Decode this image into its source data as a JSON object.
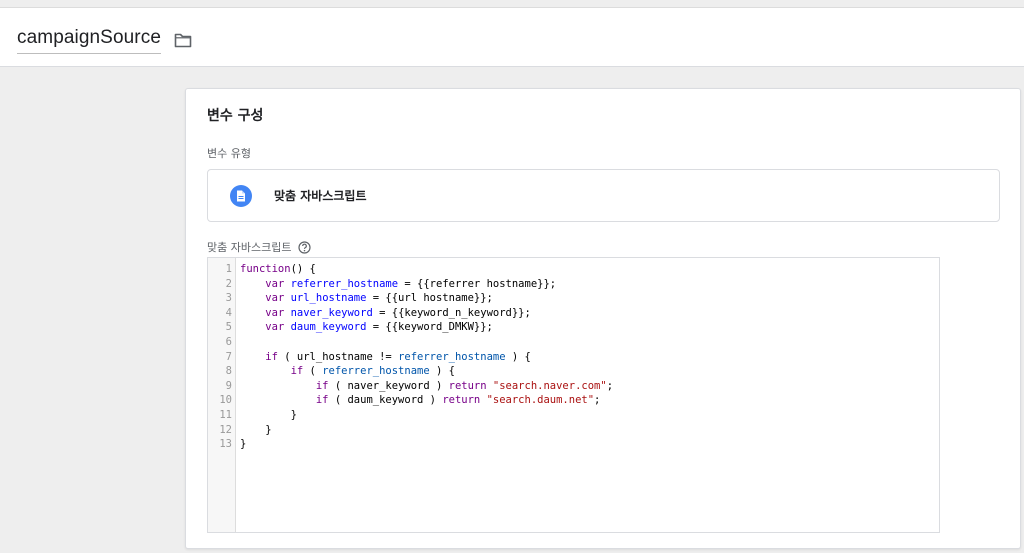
{
  "header": {
    "title": "campaignSource",
    "folder_icon": "folder-icon"
  },
  "card": {
    "title": "변수 구성",
    "type_section_label": "변수 유형",
    "type_selected": "맞춤 자바스크립트",
    "type_icon": "document-icon",
    "code_section_label": "맞춤 자바스크립트",
    "help_icon": "help-icon"
  },
  "editor": {
    "line_numbers": [
      "1",
      "2",
      "3",
      "4",
      "5",
      "6",
      "7",
      "8",
      "9",
      "10",
      "11",
      "12",
      "13"
    ],
    "lines": [
      [
        {
          "t": "kw",
          "v": "function"
        },
        {
          "t": "",
          "v": "() {"
        }
      ],
      [
        {
          "t": "",
          "v": "    "
        },
        {
          "t": "kw",
          "v": "var"
        },
        {
          "t": "",
          "v": " "
        },
        {
          "t": "def",
          "v": "referrer_hostname"
        },
        {
          "t": "",
          "v": " = {{referrer hostname}};"
        }
      ],
      [
        {
          "t": "",
          "v": "    "
        },
        {
          "t": "kw",
          "v": "var"
        },
        {
          "t": "",
          "v": " "
        },
        {
          "t": "def",
          "v": "url_hostname"
        },
        {
          "t": "",
          "v": " = {{url hostname}};"
        }
      ],
      [
        {
          "t": "",
          "v": "    "
        },
        {
          "t": "kw",
          "v": "var"
        },
        {
          "t": "",
          "v": " "
        },
        {
          "t": "def",
          "v": "naver_keyword"
        },
        {
          "t": "",
          "v": " = {{keyword_n_keyword}};"
        }
      ],
      [
        {
          "t": "",
          "v": "    "
        },
        {
          "t": "kw",
          "v": "var"
        },
        {
          "t": "",
          "v": " "
        },
        {
          "t": "def",
          "v": "daum_keyword"
        },
        {
          "t": "",
          "v": " = {{keyword_DMKW}};"
        }
      ],
      [
        {
          "t": "",
          "v": ""
        }
      ],
      [
        {
          "t": "",
          "v": "    "
        },
        {
          "t": "kw",
          "v": "if"
        },
        {
          "t": "",
          "v": " ( url_hostname != "
        },
        {
          "t": "vr",
          "v": "referrer_hostname"
        },
        {
          "t": "",
          "v": " ) {"
        }
      ],
      [
        {
          "t": "",
          "v": "        "
        },
        {
          "t": "kw",
          "v": "if"
        },
        {
          "t": "",
          "v": " ( "
        },
        {
          "t": "vr",
          "v": "referrer_hostname"
        },
        {
          "t": "",
          "v": " ) {"
        }
      ],
      [
        {
          "t": "",
          "v": "            "
        },
        {
          "t": "kw",
          "v": "if"
        },
        {
          "t": "",
          "v": " ( naver_keyword ) "
        },
        {
          "t": "kw",
          "v": "return"
        },
        {
          "t": "",
          "v": " "
        },
        {
          "t": "str",
          "v": "\"search.naver.com\""
        },
        {
          "t": "",
          "v": ";"
        }
      ],
      [
        {
          "t": "",
          "v": "            "
        },
        {
          "t": "kw",
          "v": "if"
        },
        {
          "t": "",
          "v": " ( daum_keyword ) "
        },
        {
          "t": "kw",
          "v": "return"
        },
        {
          "t": "",
          "v": " "
        },
        {
          "t": "str",
          "v": "\"search.daum.net\""
        },
        {
          "t": "",
          "v": ";"
        }
      ],
      [
        {
          "t": "",
          "v": "        }"
        }
      ],
      [
        {
          "t": "",
          "v": "    }"
        }
      ],
      [
        {
          "t": "",
          "v": "}"
        }
      ]
    ]
  },
  "colors": {
    "accent_blue": "#4285f4",
    "keyword": "#770088",
    "definition": "#0000ff",
    "string": "#aa1111",
    "variable": "#0055aa"
  }
}
